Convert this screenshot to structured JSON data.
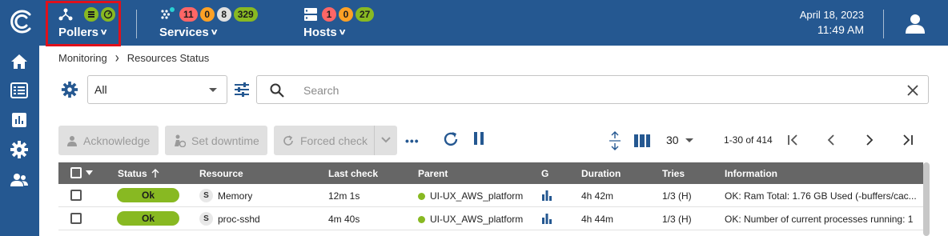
{
  "header": {
    "pollers": {
      "label": "Pollers"
    },
    "services": {
      "label": "Services",
      "counts": [
        "11",
        "0",
        "8",
        "329"
      ]
    },
    "hosts": {
      "label": "Hosts",
      "counts": [
        "1",
        "0",
        "27"
      ]
    },
    "date": "April 18, 2023",
    "time": "11:49 AM"
  },
  "breadcrumb": {
    "root": "Monitoring",
    "separator": "›",
    "current": "Resources Status"
  },
  "filters": {
    "selected": "All",
    "search_placeholder": "Search"
  },
  "actions": {
    "acknowledge": "Acknowledge",
    "set_downtime": "Set downtime",
    "forced_check": "Forced check",
    "more": "•••"
  },
  "pagination": {
    "per_page": "30",
    "range": "1-30 of 414"
  },
  "table": {
    "columns": [
      "Status",
      "Resource",
      "Last check",
      "Parent",
      "G",
      "Duration",
      "Tries",
      "Information"
    ],
    "rows": [
      {
        "status": "Ok",
        "type": "S",
        "resource": "Memory",
        "last_check": "12m 1s",
        "parent": "UI-UX_AWS_platform",
        "duration": "4h 42m",
        "tries": "1/3 (H)",
        "information": "OK: Ram Total: 1.76 GB Used (-buffers/cac..."
      },
      {
        "status": "Ok",
        "type": "S",
        "resource": "proc-sshd",
        "last_check": "4m 40s",
        "parent": "UI-UX_AWS_platform",
        "duration": "4h 44m",
        "tries": "1/3 (H)",
        "information": "OK: Number of current processes running: 1"
      }
    ]
  },
  "colors": {
    "brand": "#255891",
    "ok": "#88b922",
    "critical": "#ff6666",
    "warning": "#ffa125",
    "unknown": "#e0e0e0",
    "highlight": "#e0101b"
  }
}
